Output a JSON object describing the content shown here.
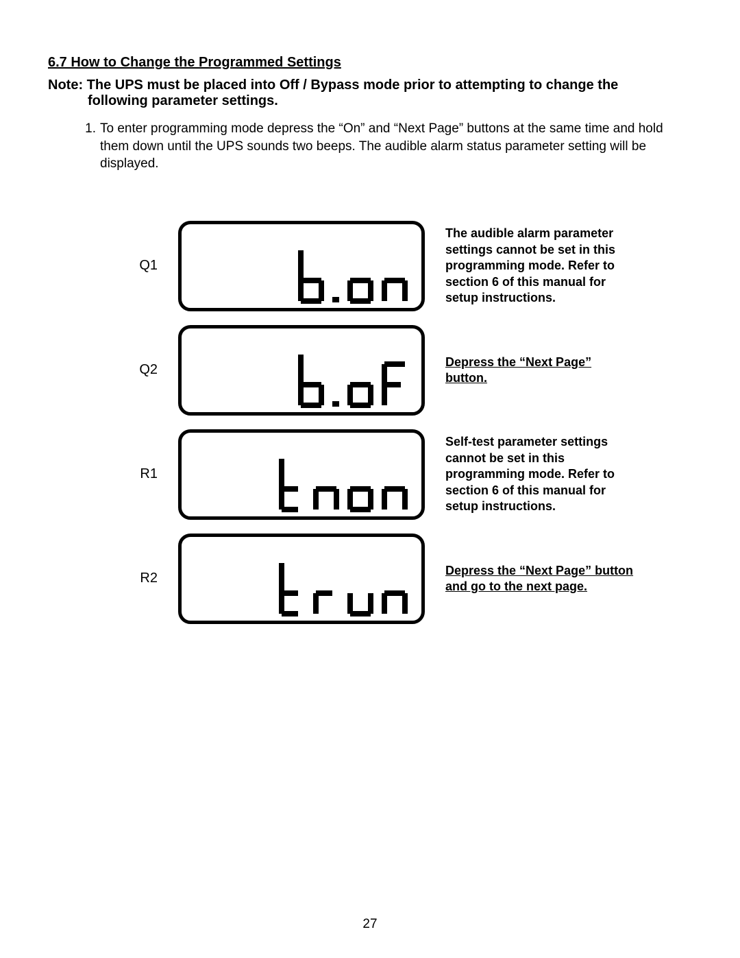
{
  "section": {
    "heading": "6.7 How to Change the Programmed Settings"
  },
  "note": {
    "line1": "Note: The UPS must be placed into Off / Bypass mode prior to attempting to change the",
    "line2": "following parameter settings."
  },
  "step": {
    "number": "1.",
    "text": "To enter programming mode depress the “On” and “Next Page” buttons at the same time and hold them down until the UPS sounds two beeps. The audible alarm status parameter setting will be displayed."
  },
  "lcd": {
    "rows": [
      {
        "label": "Q1",
        "display_code": "b.on",
        "caption": "The audible alarm parameter settings cannot be set in this programming mode. Refer to section 6 of this manual for setup instructions.",
        "underlined": false
      },
      {
        "label": "Q2",
        "display_code": "b.oF",
        "caption": "Depress the “Next Page” button.",
        "underlined": true
      },
      {
        "label": "R1",
        "display_code": "tnon",
        "caption": "Self-test parameter settings cannot be set in this programming mode. Refer to section 6 of this manual for setup instructions.",
        "underlined": false
      },
      {
        "label": "R2",
        "display_code": "trun",
        "caption": "Depress the “Next Page” button and go to the next page.",
        "underlined": true
      }
    ]
  },
  "page_number": "27"
}
